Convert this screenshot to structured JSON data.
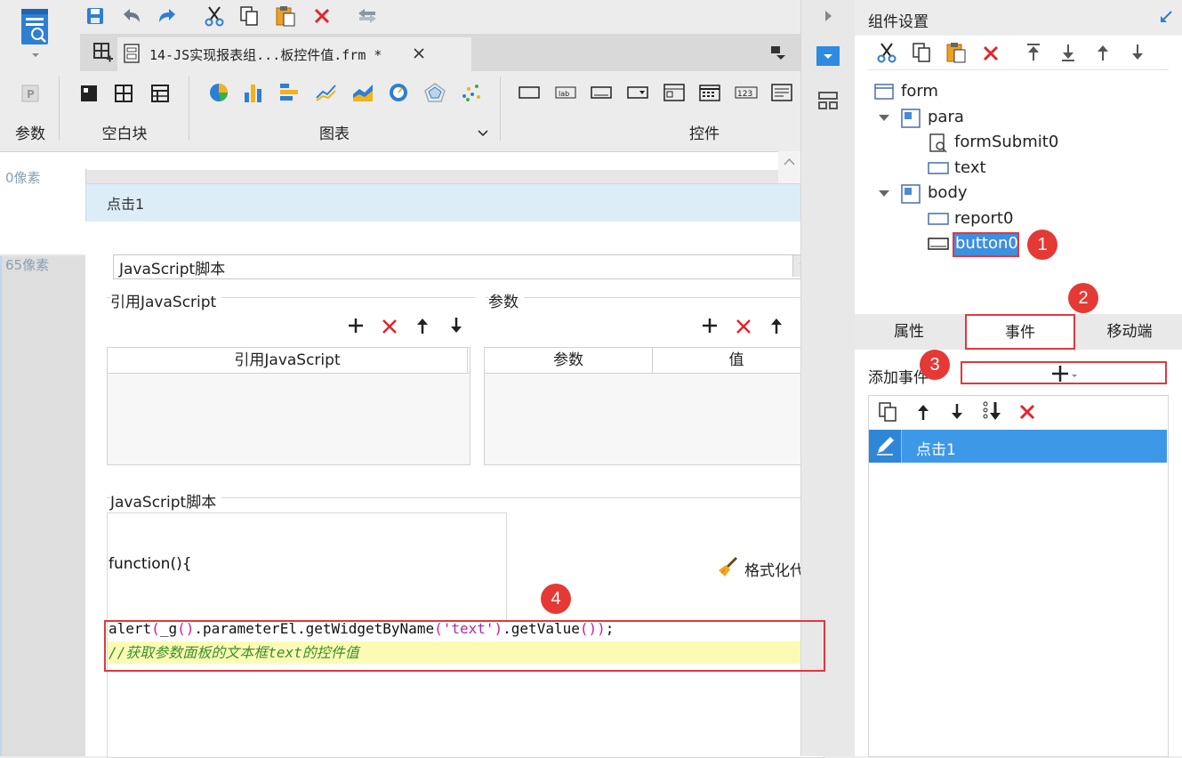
{
  "file_tab": {
    "title": "14-JS实现报表组...板控件值.frm *",
    "close_icon": "close-icon"
  },
  "ribbon": {
    "groups": [
      {
        "label": "参数"
      },
      {
        "label": "空白块"
      },
      {
        "label": "图表"
      },
      {
        "label": "控件"
      }
    ]
  },
  "canvas": {
    "para_offset": "0像素",
    "body_offset": "65像素"
  },
  "dialog": {
    "title": "点击1",
    "type_select": "JavaScript脚本",
    "ref_js_section": "引用JavaScript",
    "ref_js_column": "引用JavaScript",
    "params_section": "参数",
    "params_columns": [
      "参数",
      "值"
    ],
    "script_section": "JavaScript脚本",
    "function_open": "function(){",
    "format_button": "格式化代码",
    "code_line1": "alert(_g().parameterEl.getWidgetByName('text').getValue());",
    "code_line2": "//获取参数面板的文本框text的控件值"
  },
  "right_panel": {
    "title": "组件设置",
    "tree": [
      {
        "label": "form"
      },
      {
        "label": "para"
      },
      {
        "label": "formSubmit0"
      },
      {
        "label": "text"
      },
      {
        "label": "body"
      },
      {
        "label": "report0"
      },
      {
        "label": "button0",
        "selected": true
      }
    ],
    "tabs": [
      "属性",
      "事件",
      "移动端"
    ],
    "active_tab": "事件",
    "add_event_label": "添加事件",
    "events": [
      "点击1"
    ]
  },
  "callouts": [
    "1",
    "2",
    "3",
    "4"
  ],
  "colors": {
    "accent": "#3d98e8",
    "callout": "#e53935",
    "dialog_header": "#dcedf8",
    "code_highlight": "#fbfbb6"
  }
}
